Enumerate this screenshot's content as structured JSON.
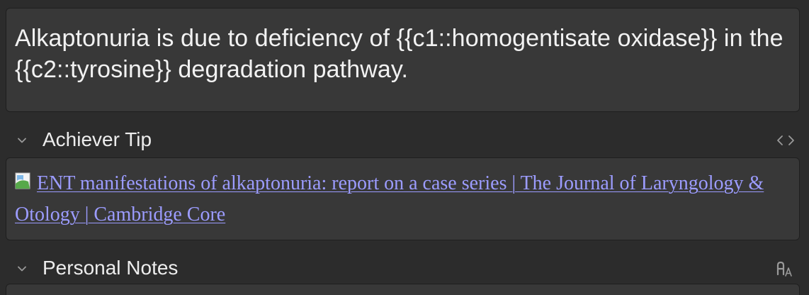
{
  "text_field": {
    "content": "Alkaptonuria is due to deficiency of {{c1::homogentisate oxidase}} in the {{c2::tyrosine}} degradation pathway."
  },
  "achiever_tip": {
    "label": "Achiever Tip",
    "collapse_icon": "chevron-down-icon",
    "toggle_icon": "code-brackets-icon",
    "link_text": "ENT manifestations of alkaptonuria: report on a case series | The Journal of Laryngology & Otology | Cambridge Core",
    "image_icon": "broken-image-icon",
    "link_color": "#9c9cff"
  },
  "personal_notes": {
    "label": "Personal Notes",
    "collapse_icon": "chevron-down-icon",
    "toggle_icon": "rich-text-format-icon"
  },
  "colors": {
    "background": "#2c2c2c",
    "field_background": "#383838",
    "text": "#ececec"
  }
}
